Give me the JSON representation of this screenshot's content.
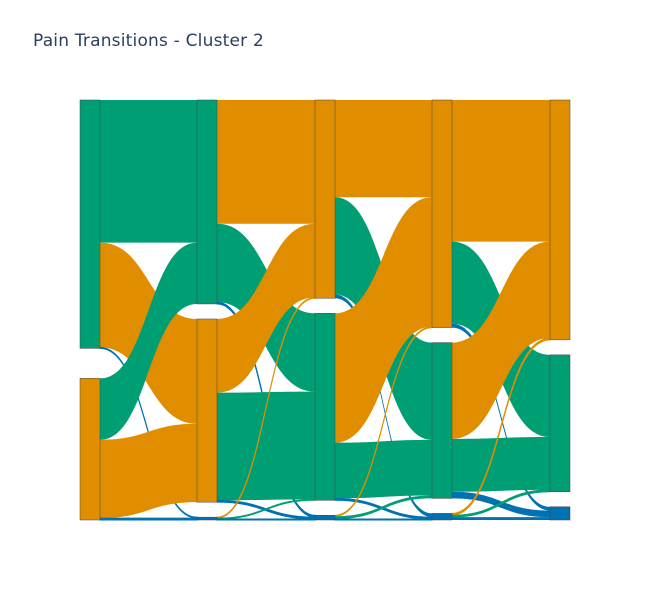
{
  "chart_data": {
    "type": "sankey",
    "title": "Pain Transitions - Cluster 2",
    "colors": {
      "green": "#009e73",
      "orange": "#e08e00",
      "blue": "#0072b2",
      "node_border": "#444444"
    },
    "stages": [
      {
        "index": 0,
        "nodes": [
          {
            "id": "s0-green",
            "color_key": "green",
            "value": 263
          },
          {
            "id": "s0-orange",
            "color_key": "orange",
            "value": 150
          }
        ]
      },
      {
        "index": 1,
        "nodes": [
          {
            "id": "s1-green",
            "color_key": "green",
            "value": 216
          },
          {
            "id": "s1-orange",
            "color_key": "orange",
            "value": 194
          },
          {
            "id": "s1-blue",
            "color_key": "blue",
            "value": 3
          }
        ]
      },
      {
        "index": 2,
        "nodes": [
          {
            "id": "s2-orange",
            "color_key": "orange",
            "value": 210
          },
          {
            "id": "s2-green",
            "color_key": "green",
            "value": 198
          },
          {
            "id": "s2-blue",
            "color_key": "blue",
            "value": 5
          }
        ]
      },
      {
        "index": 3,
        "nodes": [
          {
            "id": "s3-orange",
            "color_key": "orange",
            "value": 241
          },
          {
            "id": "s3-green",
            "color_key": "green",
            "value": 165
          },
          {
            "id": "s3-blue",
            "color_key": "blue",
            "value": 7
          }
        ]
      },
      {
        "index": 4,
        "nodes": [
          {
            "id": "s4-orange",
            "color_key": "orange",
            "value": 254
          },
          {
            "id": "s4-green",
            "color_key": "green",
            "value": 145
          },
          {
            "id": "s4-blue",
            "color_key": "blue",
            "value": 14
          }
        ]
      }
    ],
    "links": [
      {
        "source": "s0-green",
        "target": "s1-green",
        "value": 151
      },
      {
        "source": "s0-green",
        "target": "s1-orange",
        "value": 111
      },
      {
        "source": "s0-green",
        "target": "s1-blue",
        "value": 1
      },
      {
        "source": "s0-orange",
        "target": "s1-green",
        "value": 65
      },
      {
        "source": "s0-orange",
        "target": "s1-orange",
        "value": 83
      },
      {
        "source": "s0-orange",
        "target": "s1-blue",
        "value": 2
      },
      {
        "source": "s1-green",
        "target": "s2-orange",
        "value": 131
      },
      {
        "source": "s1-green",
        "target": "s2-green",
        "value": 83
      },
      {
        "source": "s1-green",
        "target": "s2-blue",
        "value": 2
      },
      {
        "source": "s1-orange",
        "target": "s2-orange",
        "value": 78
      },
      {
        "source": "s1-orange",
        "target": "s2-green",
        "value": 114
      },
      {
        "source": "s1-orange",
        "target": "s2-blue",
        "value": 2
      },
      {
        "source": "s1-blue",
        "target": "s2-orange",
        "value": 1
      },
      {
        "source": "s1-blue",
        "target": "s2-green",
        "value": 1
      },
      {
        "source": "s1-blue",
        "target": "s2-blue",
        "value": 1
      },
      {
        "source": "s2-orange",
        "target": "s3-orange",
        "value": 103
      },
      {
        "source": "s2-orange",
        "target": "s3-green",
        "value": 103
      },
      {
        "source": "s2-orange",
        "target": "s3-blue",
        "value": 4
      },
      {
        "source": "s2-green",
        "target": "s3-orange",
        "value": 137
      },
      {
        "source": "s2-green",
        "target": "s3-green",
        "value": 59
      },
      {
        "source": "s2-green",
        "target": "s3-blue",
        "value": 2
      },
      {
        "source": "s2-blue",
        "target": "s3-orange",
        "value": 1
      },
      {
        "source": "s2-blue",
        "target": "s3-green",
        "value": 3
      },
      {
        "source": "s2-blue",
        "target": "s3-blue",
        "value": 1
      },
      {
        "source": "s3-orange",
        "target": "s4-orange",
        "value": 150
      },
      {
        "source": "s3-orange",
        "target": "s4-green",
        "value": 87
      },
      {
        "source": "s3-orange",
        "target": "s4-blue",
        "value": 4
      },
      {
        "source": "s3-green",
        "target": "s4-orange",
        "value": 102
      },
      {
        "source": "s3-green",
        "target": "s4-green",
        "value": 56
      },
      {
        "source": "s3-green",
        "target": "s4-blue",
        "value": 7
      },
      {
        "source": "s3-blue",
        "target": "s4-orange",
        "value": 2
      },
      {
        "source": "s3-blue",
        "target": "s4-green",
        "value": 2
      },
      {
        "source": "s3-blue",
        "target": "s4-blue",
        "value": 3
      }
    ]
  }
}
